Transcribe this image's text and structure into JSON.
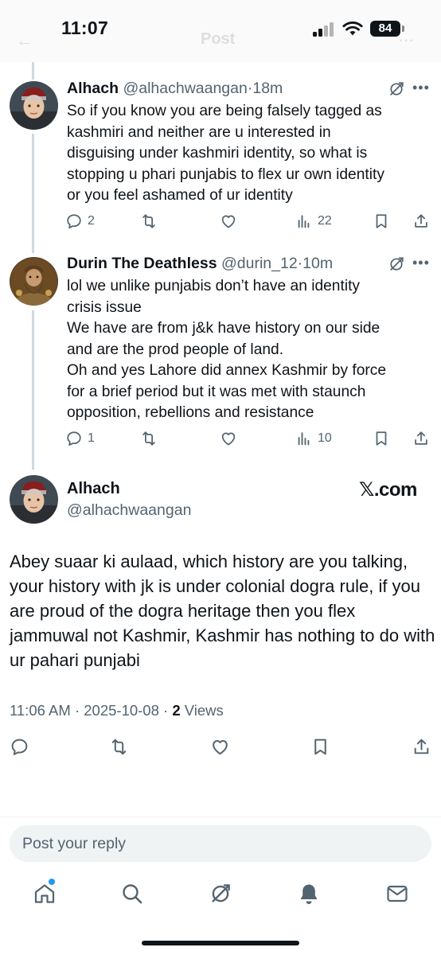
{
  "status_bar": {
    "time": "11:07",
    "battery": "84"
  },
  "header": {
    "back_glyph": "←",
    "title": "Post",
    "more_glyph": "⋯"
  },
  "tweets": [
    {
      "name": "Alhach",
      "handle": "@alhachwaangan",
      "time": "18m",
      "body": "So if you know you are being falsely tagged as\nkashmiri and neither are u interested in\ndisguising under kashmiri identity, so what is\nstopping u phari punjabis to flex ur own identity\nor you feel ashamed of ur identity",
      "replies": "2",
      "reposts": "",
      "likes": "",
      "views": "22"
    },
    {
      "name": "Durin The Deathless",
      "handle": "@durin_12",
      "time": "10m",
      "body": "lol we unlike punjabis don’t have an identity\ncrisis issue\nWe have are from j&k have history on our side\nand are the prod people of land.\nOh and yes Lahore did annex Kashmir by force\nfor a brief period but it was met with staunch\nopposition, rebellions and resistance",
      "replies": "1",
      "reposts": "",
      "likes": "",
      "views": "10"
    }
  ],
  "main_tweet": {
    "name": "Alhach",
    "handle": "@alhachwaangan",
    "watermark": "𝕏.com",
    "body": "Abey suaar ki aulaad, which history are you talking, your history with jk is under colonial dogra rule, if you are proud of the dogra heritage then you flex jammuwal not Kashmir, Kashmir has nothing to do with ur pahari punjabi",
    "time": "11:06 AM",
    "date": "2025-10-08",
    "views_count": "2",
    "views_label": "Views"
  },
  "reply": {
    "placeholder": "Post your reply"
  },
  "colors": {
    "text": "#0f1419",
    "secondary": "#536471",
    "accent": "#1d9bf0",
    "line": "#cfd9de"
  },
  "icons": [
    "reply-icon",
    "repost-icon",
    "like-icon",
    "views-icon",
    "bookmark-icon",
    "share-icon",
    "grok-icon",
    "home-icon",
    "search-icon",
    "notifications-icon",
    "messages-icon"
  ]
}
